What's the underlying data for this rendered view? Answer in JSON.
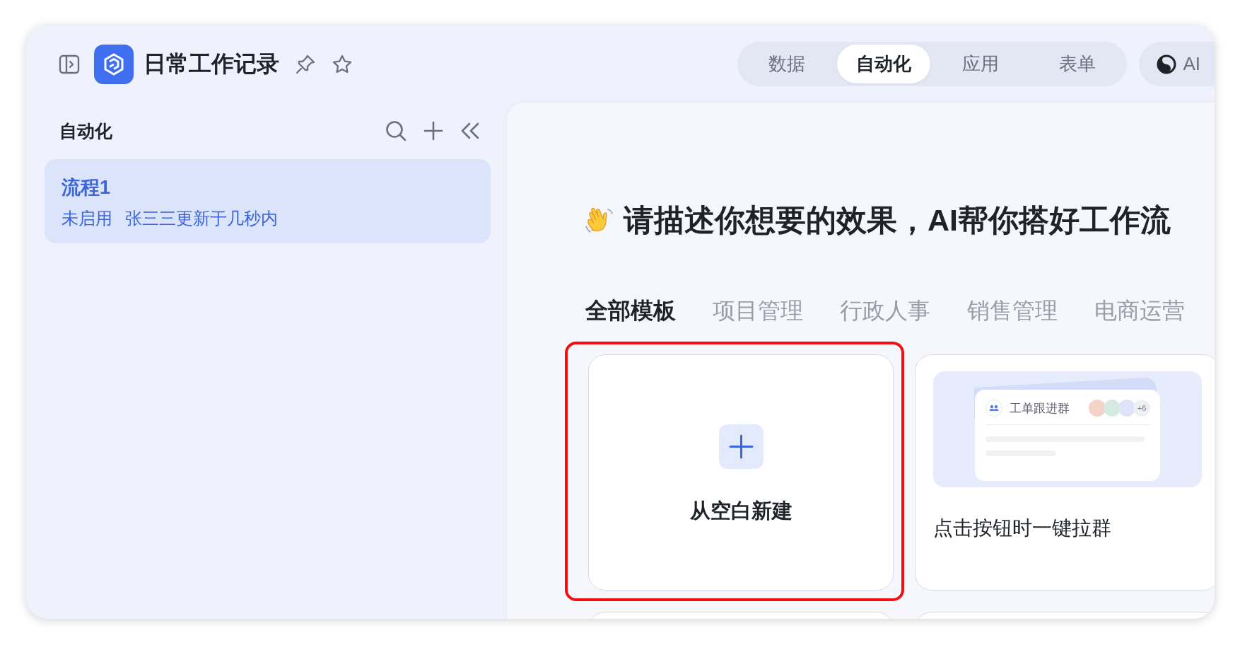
{
  "app": {
    "title": "日常工作记录"
  },
  "nav_tabs": [
    {
      "label": "数据",
      "selected": false
    },
    {
      "label": "自动化",
      "selected": true
    },
    {
      "label": "应用",
      "selected": false
    },
    {
      "label": "表单",
      "selected": false
    }
  ],
  "ai_button": {
    "label": "AI"
  },
  "sidebar": {
    "title": "自动化",
    "items": [
      {
        "title": "流程1",
        "status": "未启用",
        "updated": "张三三更新于几秒内",
        "selected": true
      }
    ]
  },
  "main": {
    "heading": "请描述你想要的效果，AI帮你搭好工作流",
    "template_tabs": [
      {
        "label": "全部模板",
        "selected": true
      },
      {
        "label": "项目管理",
        "selected": false
      },
      {
        "label": "行政人事",
        "selected": false
      },
      {
        "label": "销售管理",
        "selected": false
      },
      {
        "label": "电商运营",
        "selected": false
      }
    ],
    "templates": [
      {
        "kind": "blank",
        "label": "从空白新建",
        "highlighted": true
      },
      {
        "kind": "preview",
        "label": "点击按钮时一键拉群",
        "group_name": "工单跟进群",
        "member_count": "+6"
      },
      {
        "kind": "empty"
      },
      {
        "kind": "empty"
      }
    ]
  }
}
